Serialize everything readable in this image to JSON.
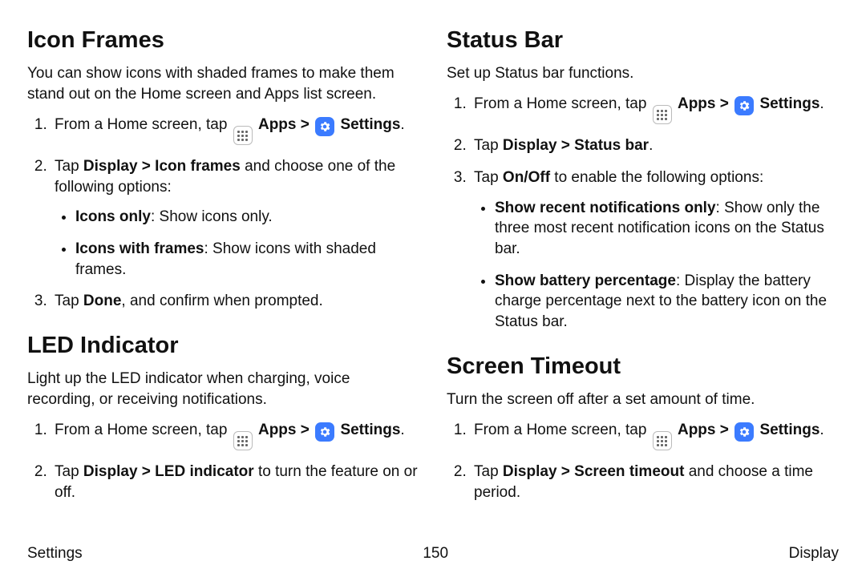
{
  "left": {
    "iconFrames": {
      "title": "Icon Frames",
      "intro": "You can show icons with shaded frames to make them stand out on the Home screen and Apps list screen.",
      "step1_a": "From a Home screen, tap",
      "apps_label": "Apps",
      "chev": ">",
      "settings_label": "Settings",
      "step1_end": ".",
      "step2_a": "Tap ",
      "step2_b": "Display > Icon frames",
      "step2_c": " and choose one of the following options:",
      "opt1_b": "Icons only",
      "opt1_t": ": Show icons only.",
      "opt2_b": "Icons with frames",
      "opt2_t": ": Show icons with shaded frames.",
      "step3_a": "Tap ",
      "step3_b": "Done",
      "step3_c": ", and confirm when prompted."
    },
    "led": {
      "title": "LED Indicator",
      "intro": "Light up the LED indicator when charging, voice recording, or receiving notifications.",
      "step1_a": "From a Home screen, tap",
      "apps_label": "Apps",
      "chev": ">",
      "settings_label": "Settings",
      "step1_end": ".",
      "step2_a": "Tap ",
      "step2_b": "Display > LED indicator",
      "step2_c": " to turn the feature on or off."
    }
  },
  "right": {
    "statusBar": {
      "title": "Status Bar",
      "intro": "Set up Status bar functions.",
      "step1_a": "From a Home screen, tap",
      "apps_label": "Apps",
      "chev": ">",
      "settings_label": "Settings",
      "step1_end": ".",
      "step2_a": "Tap ",
      "step2_b": "Display > Status bar",
      "step2_c": ".",
      "step3_a": "Tap ",
      "step3_b": "On/Off",
      "step3_c": " to enable the following options:",
      "opt1_b": "Show recent notifications only",
      "opt1_t": ": Show only the three most recent notification icons on the Status bar.",
      "opt2_b": "Show battery percentage",
      "opt2_t": ": Display the battery charge percentage next to the battery icon on the Status bar."
    },
    "timeout": {
      "title": "Screen Timeout",
      "intro": "Turn the screen off after a set amount of time.",
      "step1_a": "From a Home screen, tap",
      "apps_label": "Apps",
      "chev": ">",
      "settings_label": "Settings",
      "step1_end": ".",
      "step2_a": "Tap ",
      "step2_b": "Display > Screen timeout",
      "step2_c": " and choose a time period."
    }
  },
  "footer": {
    "left": "Settings",
    "center": "150",
    "right": "Display"
  }
}
